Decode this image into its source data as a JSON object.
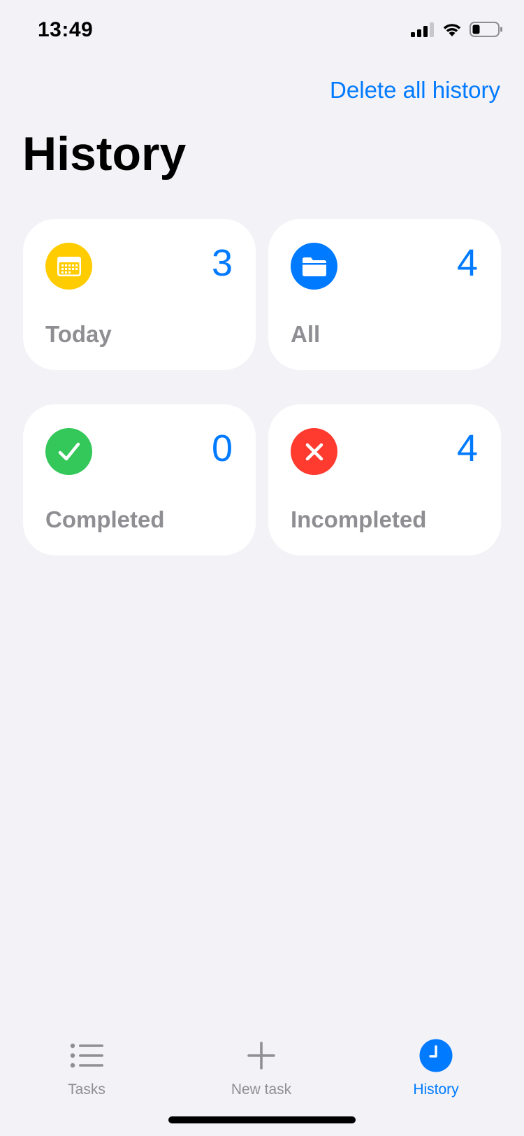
{
  "status_bar": {
    "time": "13:49",
    "icons": [
      "signal-icon",
      "wifi-icon",
      "battery-icon"
    ]
  },
  "nav": {
    "delete_label": "Delete all history"
  },
  "title": "History",
  "cards": [
    {
      "label": "Today",
      "count": "3",
      "icon": "calendar-icon",
      "color": "#FFCC00"
    },
    {
      "label": "All",
      "count": "4",
      "icon": "folder-icon",
      "color": "#007AFF"
    },
    {
      "label": "Completed",
      "count": "0",
      "icon": "checkmark-icon",
      "color": "#34C759"
    },
    {
      "label": "Incompleted",
      "count": "4",
      "icon": "xmark-icon",
      "color": "#FF3B30"
    }
  ],
  "tab_bar": {
    "items": [
      {
        "label": "Tasks",
        "icon": "list-icon",
        "active": false
      },
      {
        "label": "New task",
        "icon": "plus-icon",
        "active": false
      },
      {
        "label": "History",
        "icon": "clock-icon",
        "active": true
      }
    ]
  },
  "colors": {
    "accent": "#007AFF",
    "background": "#F2F2F7",
    "secondary_text": "#8E8E93"
  }
}
